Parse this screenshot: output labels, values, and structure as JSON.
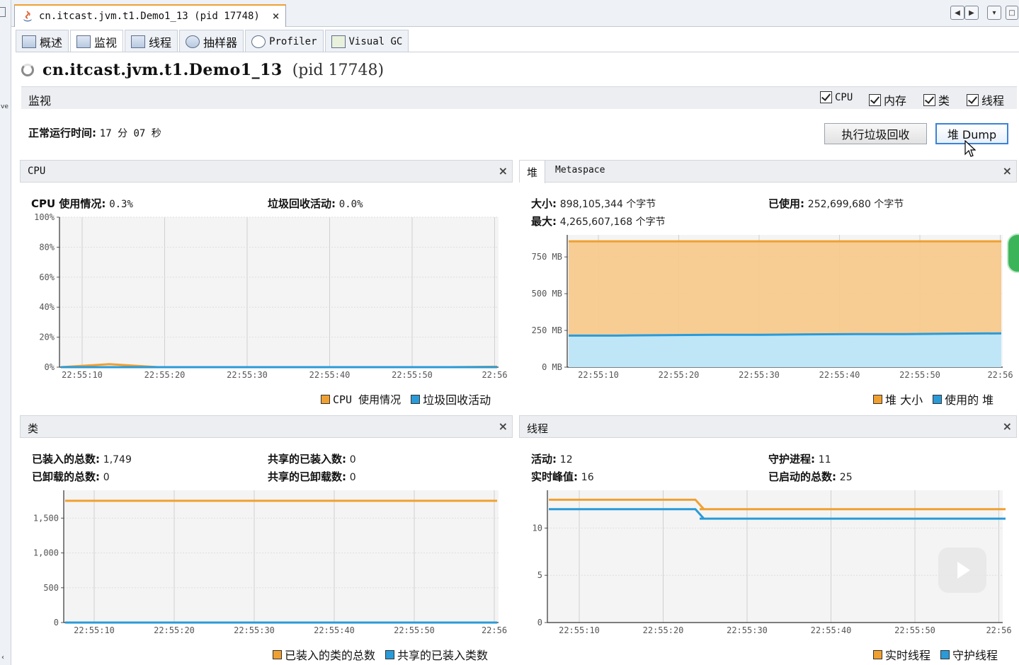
{
  "window": {
    "doc_tab_title": "cn.itcast.jvm.t1.Demo1_13 (pid 17748)",
    "doc_tab_close": "×"
  },
  "view_tabs": [
    {
      "label": "概述",
      "icon": "overview-icon"
    },
    {
      "label": "监视",
      "icon": "monitor-icon",
      "active": true
    },
    {
      "label": "线程",
      "icon": "threads-icon"
    },
    {
      "label": "抽样器",
      "icon": "sampler-icon"
    },
    {
      "label": "Profiler",
      "icon": "profiler-icon"
    },
    {
      "label": "Visual GC",
      "icon": "visualgc-icon"
    }
  ],
  "title": {
    "name": "cn.itcast.jvm.t1.Demo1_13",
    "pid": "(pid 17748)"
  },
  "monitor": {
    "label": "监视",
    "checkboxes": [
      {
        "label": "CPU",
        "checked": true
      },
      {
        "label": "内存",
        "checked": true
      },
      {
        "label": "类",
        "checked": true
      },
      {
        "label": "线程",
        "checked": true
      }
    ],
    "uptime_label": "正常运行时间:",
    "uptime_value": "17 分 07 秒",
    "gc_button": "执行垃圾回收",
    "heap_dump_button": "堆 Dump"
  },
  "cpu_panel": {
    "title": "CPU",
    "close": "×",
    "cpu_usage_label": "CPU 使用情况:",
    "cpu_usage_value": "0.3%",
    "gc_activity_label": "垃圾回收活动:",
    "gc_activity_value": "0.0%",
    "legend": [
      "CPU 使用情况",
      "垃圾回收活动"
    ]
  },
  "heap_panel": {
    "tabs": [
      "堆",
      "Metaspace"
    ],
    "close": "×",
    "size_label": "大小:",
    "size_value": "898,105,344 个字节",
    "used_label": "已使用:",
    "used_value": "252,699,680 个字节",
    "max_label": "最大:",
    "max_value": "4,265,607,168 个字节",
    "legend": [
      "堆 大小",
      "使用的 堆"
    ]
  },
  "classes_panel": {
    "title": "类",
    "close": "×",
    "loaded_label": "已装入的总数:",
    "loaded_value": "1,749",
    "unloaded_label": "已卸载的总数:",
    "unloaded_value": "0",
    "shared_loaded_label": "共享的已装入数:",
    "shared_loaded_value": "0",
    "shared_unloaded_label": "共享的已卸载数:",
    "shared_unloaded_value": "0",
    "legend": [
      "已装入的类的总数",
      "共享的已装入类数"
    ]
  },
  "threads_panel": {
    "title": "线程",
    "close": "×",
    "live_label": "活动:",
    "live_value": "12",
    "peak_label": "实时峰值:",
    "peak_value": "16",
    "daemon_label": "守护进程:",
    "daemon_value": "11",
    "started_label": "已启动的总数:",
    "started_value": "25",
    "legend": [
      "实时线程",
      "守护线程"
    ]
  },
  "colors": {
    "orange": "#f0a030",
    "blue": "#2a9ad8",
    "orange_fill": "#f7c98a",
    "blue_fill": "#bfe6f7"
  },
  "chart_data": [
    {
      "id": "cpu",
      "type": "line",
      "x": [
        "22:55:10",
        "22:55:20",
        "22:55:30",
        "22:55:40",
        "22:55:50",
        "22:56"
      ],
      "y_ticks": [
        "100%",
        "80%",
        "60%",
        "40%",
        "20%",
        "0%"
      ],
      "ylim": [
        0,
        100
      ],
      "series": [
        {
          "name": "CPU 使用情况",
          "color": "#f0a030",
          "values": [
            0,
            2,
            0,
            0,
            0,
            0,
            0,
            0,
            0,
            0.3
          ]
        },
        {
          "name": "垃圾回收活动",
          "color": "#2a9ad8",
          "values": [
            0,
            0,
            0,
            0,
            0,
            0,
            0,
            0,
            0,
            0
          ]
        }
      ]
    },
    {
      "id": "heap",
      "type": "area",
      "x": [
        "22:55:10",
        "22:55:20",
        "22:55:30",
        "22:55:40",
        "22:55:50",
        "22:56"
      ],
      "y_ticks": [
        "750 MB",
        "500 MB",
        "250 MB",
        "0 MB"
      ],
      "ylim": [
        0,
        900
      ],
      "series": [
        {
          "name": "堆 大小",
          "color": "#f0a030",
          "values": [
            856,
            856,
            856,
            856,
            856,
            856,
            856,
            856,
            856,
            856
          ]
        },
        {
          "name": "使用的 堆",
          "color": "#2a9ad8",
          "values": [
            215,
            215,
            218,
            220,
            220,
            223,
            225,
            225,
            228,
            230
          ]
        }
      ]
    },
    {
      "id": "classes",
      "type": "line",
      "x": [
        "22:55:10",
        "22:55:20",
        "22:55:30",
        "22:55:40",
        "22:55:50",
        "22:56"
      ],
      "y_ticks": [
        "1,500",
        "1,000",
        "500",
        "0"
      ],
      "ylim": [
        0,
        1900
      ],
      "series": [
        {
          "name": "已装入的类的总数",
          "color": "#f0a030",
          "values": [
            1749,
            1749,
            1749,
            1749,
            1749,
            1749
          ]
        },
        {
          "name": "共享的已装入类数",
          "color": "#2a9ad8",
          "values": [
            0,
            0,
            0,
            0,
            0,
            0
          ]
        }
      ]
    },
    {
      "id": "threads",
      "type": "line",
      "x": [
        "22:55:10",
        "22:55:20",
        "22:55:30",
        "22:55:40",
        "22:55:50",
        "22:56"
      ],
      "y_ticks": [
        "10",
        "5",
        "0"
      ],
      "ylim": [
        0,
        14
      ],
      "series": [
        {
          "name": "实时线程",
          "color": "#f0a030",
          "values": [
            13,
            13,
            13,
            12,
            12,
            12,
            12,
            12,
            12,
            12
          ]
        },
        {
          "name": "守护线程",
          "color": "#2a9ad8",
          "values": [
            12,
            12,
            12,
            11,
            11,
            11,
            11,
            11,
            11,
            11
          ]
        }
      ]
    }
  ]
}
